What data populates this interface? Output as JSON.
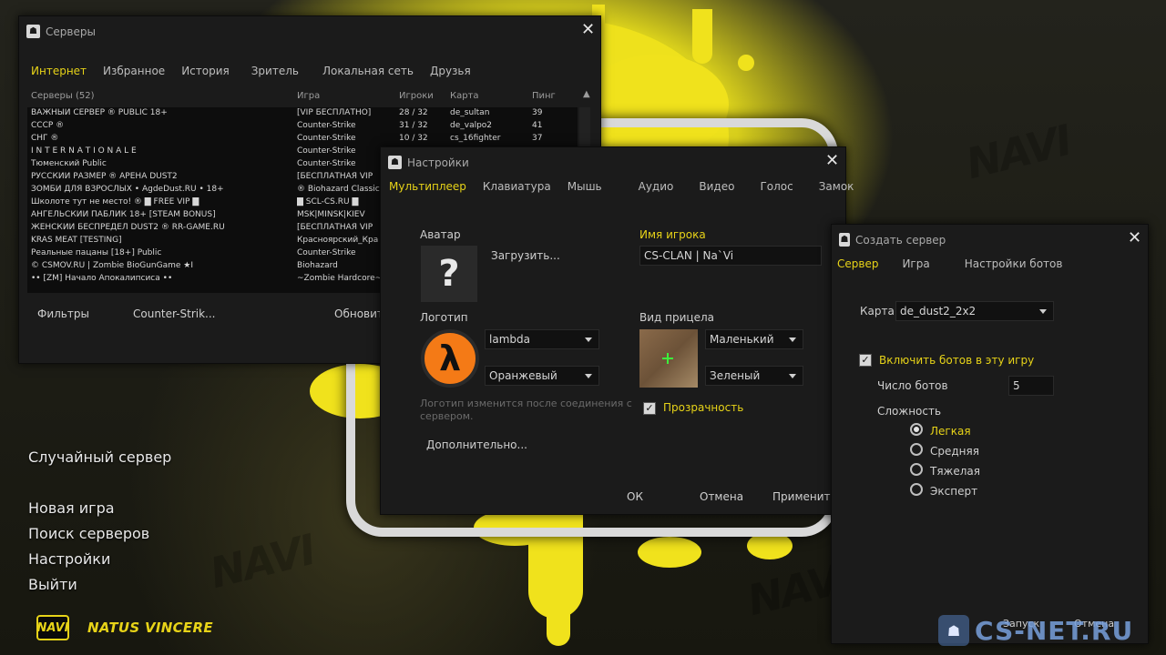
{
  "main_menu": {
    "random_server": "Случайный сервер",
    "new_game": "Новая игра",
    "find_servers": "Поиск серверов",
    "settings": "Настройки",
    "quit": "Выйти"
  },
  "branding": {
    "logo_text": "NAVI",
    "team_name": "NATUS VINCERE",
    "watermark_text": "CS-NET.RU"
  },
  "servers_window": {
    "title": "Серверы",
    "tabs": [
      {
        "label": "Интернет",
        "active": true
      },
      {
        "label": "Избранное"
      },
      {
        "label": "История"
      },
      {
        "label": "Зритель"
      },
      {
        "label": "Локальная сеть"
      },
      {
        "label": "Друзья"
      }
    ],
    "columns": {
      "servers": "Серверы (52)",
      "game": "Игра",
      "players": "Игроки",
      "map": "Карта",
      "ping": "Пинг"
    },
    "rows": [
      {
        "name": "ВАЖНЫЙ СЕРВЕР ® PUBLIC 18+",
        "game": "[VIP БЕСПЛАТНО]",
        "players": "28 / 32",
        "map": "de_sultan",
        "ping": "39"
      },
      {
        "name": "СССР ®",
        "game": "Counter-Strike",
        "players": "31 / 32",
        "map": "de_valpo2",
        "ping": "41"
      },
      {
        "name": "СНГ ®",
        "game": "Counter-Strike",
        "players": "10 / 32",
        "map": "cs_16fighter",
        "ping": "37"
      },
      {
        "name": "I N T E R N A T I O N A L E",
        "game": "Counter-Strike",
        "players": "",
        "map": "",
        "ping": ""
      },
      {
        "name": "Тюменский Public",
        "game": "Counter-Strike",
        "players": "",
        "map": "",
        "ping": ""
      },
      {
        "name": "РУССКИЙ РАЗМЕР ® АРЕНА DUST2",
        "game": "[БЕСПЛАТНАЯ VIP",
        "players": "",
        "map": "",
        "ping": ""
      },
      {
        "name": "ЗОМБИ ДЛЯ ВЗРОСЛЫХ • AgdeDust.RU • 18+",
        "game": "® Biohazard Classic",
        "players": "",
        "map": "",
        "ping": ""
      },
      {
        "name": "Школоте тут не место! ® █ FREE VIP █",
        "game": "█ SCL-CS.RU █",
        "players": "",
        "map": "",
        "ping": ""
      },
      {
        "name": "АНГЕЛЬСКИЙ ПАБЛИК 18+ [STEAM BONUS]",
        "game": "MSK|MINSK|KIEV",
        "players": "",
        "map": "",
        "ping": ""
      },
      {
        "name": "ЖЕНСКИЙ БЕСПРЕДЕЛ DUST2 ® RR-GAME.RU",
        "game": "[БЕСПЛАТНАЯ VIP",
        "players": "",
        "map": "",
        "ping": ""
      },
      {
        "name": "KRAS MEAT [TESTING]",
        "game": "Красноярский_Кра",
        "players": "",
        "map": "",
        "ping": ""
      },
      {
        "name": "Реальные пацаны [18+] Public",
        "game": "Counter-Strike",
        "players": "",
        "map": "",
        "ping": ""
      },
      {
        "name": "© CSMOV.RU | Zombie BioGunGame ★I",
        "game": "Biohazard",
        "players": "",
        "map": "",
        "ping": ""
      },
      {
        "name": "•• [ZM] Начало Апокалипсиса ••",
        "game": "~Zombie Hardcore~",
        "players": "",
        "map": "",
        "ping": ""
      }
    ],
    "filters_label": "Фильтры",
    "filter_value": "Counter-Strik...",
    "refresh_label": "Обновит"
  },
  "settings_window": {
    "title": "Настройки",
    "tabs": [
      {
        "label": "Мультиплеер",
        "active": true
      },
      {
        "label": "Клавиатура"
      },
      {
        "label": "Мышь"
      },
      {
        "label": "Аудио"
      },
      {
        "label": "Видео"
      },
      {
        "label": "Голос"
      },
      {
        "label": "Замок"
      }
    ],
    "avatar_label": "Аватар",
    "avatar_placeholder": "?",
    "upload_label": "Загрузить...",
    "player_name_label": "Имя игрока",
    "player_name_value": "CS-CLAN | Na`Vi",
    "logo_label": "Логотип",
    "logo_symbol": "λ",
    "logo_value": "lambda",
    "logo_color": "Оранжевый",
    "logo_note": "Логотип изменится после соединения с сервером.",
    "crosshair_label": "Вид прицела",
    "crosshair_size": "Маленький",
    "crosshair_color": "Зеленый",
    "transparency_label": "Прозрачность",
    "transparency_checked": true,
    "advanced_label": "Дополнительно...",
    "ok_label": "ОК",
    "cancel_label": "Отмена",
    "apply_label": "Применить"
  },
  "create_server_window": {
    "title": "Создать сервер",
    "tabs": [
      {
        "label": "Сервер",
        "active": true
      },
      {
        "label": "Игра"
      },
      {
        "label": "Настройки ботов"
      }
    ],
    "map_label": "Карта",
    "map_value": "de_dust2_2x2",
    "bots_enable_label": "Включить ботов в эту игру",
    "bots_enabled": true,
    "bot_count_label": "Число ботов",
    "bot_count_value": "5",
    "difficulty_label": "Сложность",
    "difficulties": [
      {
        "label": "Легкая",
        "selected": true
      },
      {
        "label": "Средняя"
      },
      {
        "label": "Тяжелая"
      },
      {
        "label": "Эксперт"
      }
    ],
    "start_label": "Запуск",
    "cancel_label": "Отмена"
  },
  "colors": {
    "accent": "#e7d318",
    "window_bg": "#1b1b1b",
    "text": "#cfcfcf"
  }
}
